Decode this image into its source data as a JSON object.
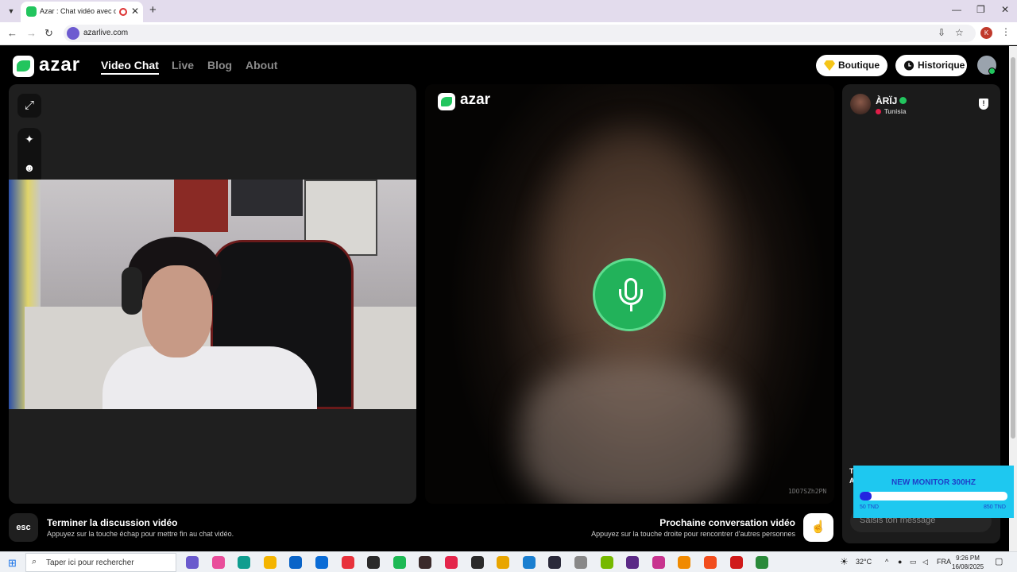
{
  "browser": {
    "tab_title": "Azar : Chat vidéo avec de n",
    "new_tab": "+",
    "url": "azarlive.com",
    "profile_initial": "K"
  },
  "header": {
    "logo": "azar",
    "nav": [
      {
        "label": "Video Chat",
        "active": true
      },
      {
        "label": "Live",
        "active": false
      },
      {
        "label": "Blog",
        "active": false
      },
      {
        "label": "About",
        "active": false
      }
    ],
    "boutique_label": "Boutique",
    "history_label": "Historique"
  },
  "center": {
    "logo": "azar",
    "stream_id": "1DO7SZh2PN"
  },
  "partner": {
    "name": "ÀRÏJ",
    "country": "Tunisia"
  },
  "chat": {
    "placeholder": "Saisis ton message"
  },
  "ad": {
    "title": "NEW MONITOR 300HZ",
    "progress_value": "7",
    "progress_fraction": 0.08,
    "min_label": "50 TND",
    "max_label": "850 TND",
    "peek_text": "T\nA"
  },
  "actions": {
    "end_key": "esc",
    "end_title": "Terminer la discussion vidéo",
    "end_subtitle": "Appuyez sur la touche échap pour mettre fin au chat vidéo.",
    "next_title": "Prochaine conversation vidéo",
    "next_subtitle": "Appuyez sur la touche droite pour rencontrer d'autres personnes"
  },
  "taskbar": {
    "search_placeholder": "Taper ici pour rechercher",
    "temperature": "32°C",
    "language": "FRA",
    "time": "9:26 PM",
    "date": "16/08/2025",
    "apps": [
      "copilot",
      "copilot-alt",
      "edge",
      "file-explorer",
      "store",
      "outlook",
      "opera",
      "steam",
      "spotify",
      "capcut",
      "tiktok",
      "capcut-alt",
      "chrome",
      "vscode",
      "obs",
      "settings",
      "nvidia",
      "photos",
      "instagram",
      "vlc",
      "brave",
      "cast",
      "chrome-active"
    ]
  },
  "colors": {
    "accent_green": "#22c55e",
    "ad_background": "#1ec8f0",
    "ad_blue": "#1e3fc9"
  }
}
